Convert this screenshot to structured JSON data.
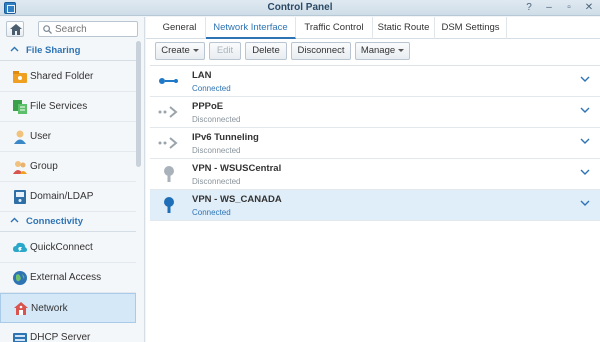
{
  "window": {
    "title": "Control Panel",
    "controls": [
      "?",
      "–",
      "▫",
      "✕"
    ]
  },
  "sidebar": {
    "search_placeholder": "Search",
    "sections": [
      {
        "label": "File Sharing"
      },
      {
        "label": "Connectivity"
      }
    ],
    "items": [
      {
        "label": "Shared Folder",
        "icon": "shared-folder-icon"
      },
      {
        "label": "File Services",
        "icon": "file-services-icon"
      },
      {
        "label": "User",
        "icon": "user-icon"
      },
      {
        "label": "Group",
        "icon": "group-icon"
      },
      {
        "label": "Domain/LDAP",
        "icon": "domain-ldap-icon"
      },
      {
        "label": "QuickConnect",
        "icon": "quickconnect-icon"
      },
      {
        "label": "External Access",
        "icon": "external-access-icon"
      },
      {
        "label": "Network",
        "icon": "network-icon",
        "selected": true
      },
      {
        "label": "DHCP Server",
        "icon": "dhcp-server-icon"
      }
    ]
  },
  "tabs": [
    "General",
    "Network Interface",
    "Traffic Control",
    "Static Route",
    "DSM Settings"
  ],
  "active_tab": "Network Interface",
  "toolbar": {
    "create": "Create",
    "edit": "Edit",
    "delete": "Delete",
    "disconnect": "Disconnect",
    "manage": "Manage"
  },
  "interfaces": [
    {
      "name": "LAN",
      "status": "Connected",
      "icon": "lan-icon"
    },
    {
      "name": "PPPoE",
      "status": "Disconnected",
      "icon": "pppoe-icon"
    },
    {
      "name": "IPv6 Tunneling",
      "status": "Disconnected",
      "icon": "ipv6-tunnel-icon"
    },
    {
      "name": "VPN - WSUSCentral",
      "status": "Disconnected",
      "icon": "vpn-icon"
    },
    {
      "name": "VPN - WS_CANADA",
      "status": "Connected",
      "icon": "vpn-icon",
      "selected": true
    }
  ],
  "colors": {
    "accent": "#2e74b5",
    "selected_bg": "#e0eef9",
    "connected": "#2e74b5",
    "disconnected": "#8a949c"
  }
}
